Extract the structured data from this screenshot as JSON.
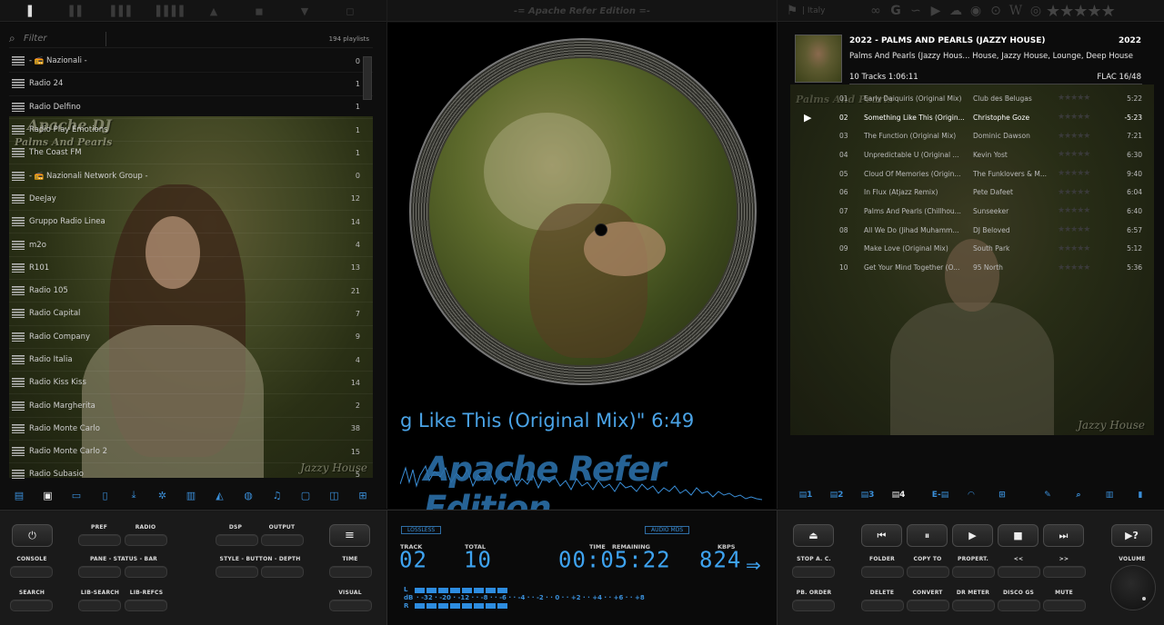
{
  "topbar": {
    "title": "-= Apache Refer Edition =-",
    "left_icons": [
      "bar-1-icon",
      "bar-2-icon",
      "bar-3-icon",
      "bar-4-icon",
      "tri-up-icon",
      "square-icon",
      "tri-down-icon",
      "square-icon-2"
    ],
    "country": "| Italy"
  },
  "playlists": {
    "filter_placeholder": "Filter",
    "count_label": "194 playlists",
    "items": [
      {
        "name": "- 📻 Nazionali -",
        "count": "0"
      },
      {
        "name": "Radio 24",
        "count": "1"
      },
      {
        "name": "Radio Delfino",
        "count": "1"
      },
      {
        "name": "Radio Play Emotions",
        "count": "1"
      },
      {
        "name": "The Coast FM",
        "count": "1"
      },
      {
        "name": "- 📻 Nazionali Network Group -",
        "count": "0"
      },
      {
        "name": "DeeJay",
        "count": "12"
      },
      {
        "name": "Gruppo Radio Linea",
        "count": "14"
      },
      {
        "name": "m2o",
        "count": "4"
      },
      {
        "name": "R101",
        "count": "13"
      },
      {
        "name": "Radio 105",
        "count": "21"
      },
      {
        "name": "Radio Capital",
        "count": "7"
      },
      {
        "name": "Radio Company",
        "count": "9"
      },
      {
        "name": "Radio Italia",
        "count": "4"
      },
      {
        "name": "Radio Kiss Kiss",
        "count": "14"
      },
      {
        "name": "Radio Margherita",
        "count": "2"
      },
      {
        "name": "Radio Monte Carlo",
        "count": "38"
      },
      {
        "name": "Radio Monte Carlo 2",
        "count": "15"
      },
      {
        "name": "Radio Subasio",
        "count": "5"
      }
    ],
    "art_caption_top": "Apache DJ",
    "art_caption_sub": "Palms And Pearls",
    "art_caption_bottom": "Jazzy House"
  },
  "center": {
    "now_playing": "g Like This (Original Mix)\" 6:49",
    "brand": "Apache Refer Edition"
  },
  "album": {
    "title": "2022 - PALMS AND PEARLS (JAZZY HOUSE)",
    "year": "2022",
    "genre_line": "Palms And Pearls (Jazzy Hous... House, Jazzy House, Lounge, Deep House",
    "tracks_line": "10 Tracks  1:06:11",
    "format_line": "FLAC  16/48",
    "art_caption_top": "Palms And Pearls",
    "art_caption_bottom": "Jazzy House",
    "tracks": [
      {
        "n": "01",
        "title": "Early Daiquiris (Original Mix)",
        "artist": "Club des Belugas",
        "dur": "5:22"
      },
      {
        "n": "02",
        "title": "Something Like This (Origin...",
        "artist": "Christophe Goze",
        "dur": "-5:23"
      },
      {
        "n": "03",
        "title": "The Function (Original Mix)",
        "artist": "Dominic Dawson",
        "dur": "7:21"
      },
      {
        "n": "04",
        "title": "Unpredictable U (Original ...",
        "artist": "Kevin Yost",
        "dur": "6:30"
      },
      {
        "n": "05",
        "title": "Cloud Of Memories (Origin...",
        "artist": "The Funklovers & M...",
        "dur": "9:40"
      },
      {
        "n": "06",
        "title": "In Flux (Atjazz Remix)",
        "artist": "Pete Dafeet",
        "dur": "6:04"
      },
      {
        "n": "07",
        "title": "Palms And Pearls (Chillhou...",
        "artist": "Sunseeker",
        "dur": "6:40"
      },
      {
        "n": "08",
        "title": "All We Do (Jihad Muhamm...",
        "artist": "DJ Beloved",
        "dur": "6:57"
      },
      {
        "n": "09",
        "title": "Make Love (Original Mix)",
        "artist": "South Park",
        "dur": "5:12"
      },
      {
        "n": "10",
        "title": "Get Your Mind Together (O...",
        "artist": "95 North",
        "dur": "5:36"
      }
    ],
    "current_index": 1,
    "tab_labels": [
      "1",
      "2",
      "3",
      "4",
      "E"
    ]
  },
  "controls_left": {
    "labels": {
      "pref": "PREF",
      "radio": "RADIO",
      "dsp": "DSP",
      "output": "OUTPUT",
      "console": "CONSOLE",
      "pane": "PANE - STATUS - BAR",
      "style": "STYLE - BUTTON - DEPTH",
      "time": "TIME",
      "search": "SEARCH",
      "lib_search": "LIB-SEARCH",
      "lib_refcs": "LIB-REFCS",
      "visual": "VISUAL"
    }
  },
  "lcd": {
    "lossless": "LOSSLESS",
    "audio": "AUDIO MDS",
    "track_lbl": "TRACK",
    "total_lbl": "TOTAL",
    "time_lbl": "TIME",
    "remaining_lbl": "REMAINING",
    "kbps_lbl": "KBPS",
    "track": "02",
    "total": "10",
    "time": "00:05:22",
    "kbps": "824",
    "meter_l": "L",
    "meter_db": "dB",
    "meter_r": "R",
    "scale": "· -32 · -20 · -12 · · -8 · · -6 · · -4 · · -2 · · 0 · · +2 · · +4 · · +6 · · +8"
  },
  "controls_right": {
    "labels": {
      "stop_ac": "STOP A. C.",
      "folder": "FOLDER",
      "copy_to": "COPY TO",
      "propert": "PROPERT.",
      "prev_p": "<<",
      "next_p": ">>",
      "volume": "VOLUME",
      "pb_order": "PB. ORDER",
      "delete": "DELETE",
      "convert": "CONVERT",
      "dr_meter": "DR METER",
      "disco_gs": "DISCO GS",
      "mute": "MUTE"
    },
    "help_label": "?"
  },
  "colors": {
    "accent": "#3a8fd9",
    "lcd": "#3ea3f0",
    "bg": "#0b0b0b"
  }
}
